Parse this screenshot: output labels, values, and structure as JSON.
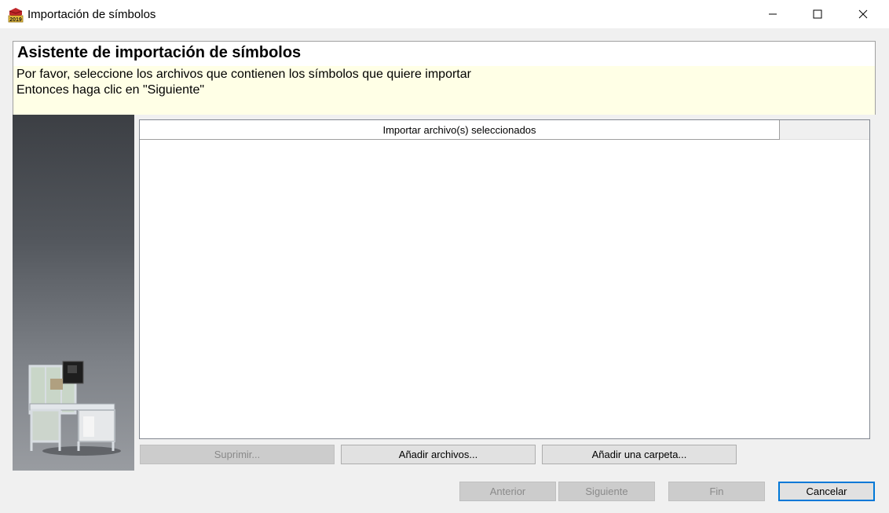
{
  "window": {
    "title": "Importación de símbolos",
    "app_icon_text": "2019"
  },
  "header": {
    "title": "Asistente de importación de símbolos",
    "line1": "Por favor, seleccione los archivos que contienen los símbolos que quiere importar",
    "line2": "Entonces haga clic en \"Siguiente\""
  },
  "file_list": {
    "column_header": "Importar archivo(s) seleccionados",
    "rows": []
  },
  "list_actions": {
    "delete_label": "Suprimir...",
    "add_files_label": "Añadir archivos...",
    "add_folder_label": "Añadir una carpeta..."
  },
  "wizard_nav": {
    "previous_label": "Anterior",
    "next_label": "Siguiente",
    "finish_label": "Fin",
    "cancel_label": "Cancelar"
  },
  "colors": {
    "header_background": "#ffffe6",
    "default_button_border": "#0078d7"
  }
}
